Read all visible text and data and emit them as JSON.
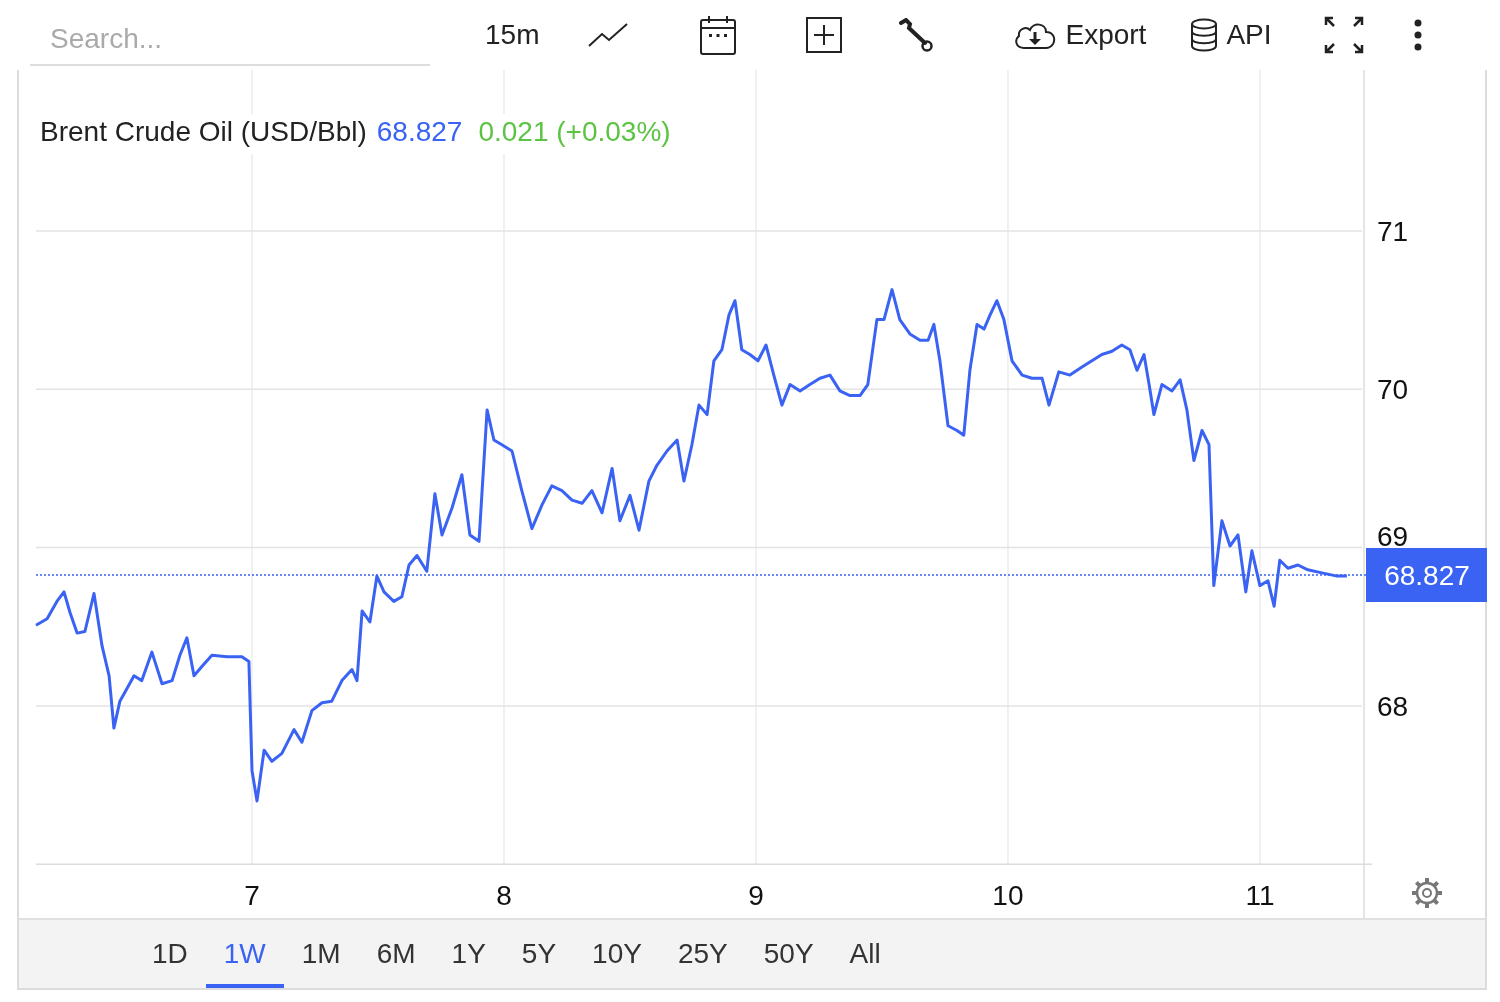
{
  "toolbar": {
    "search": {
      "placeholder": "Search..."
    },
    "interval": "15m",
    "export_label": "Export",
    "api_label": "API"
  },
  "legend": {
    "price": "68.827",
    "change": "0.021 (+0.03%)"
  },
  "chart_data": {
    "type": "line",
    "title": "Brent Crude Oil (USD/Bbl)",
    "grid": true,
    "xlim": [
      6.143,
      11.405
    ],
    "ylim": [
      67,
      72
    ],
    "ref_lines": [
      {
        "axis": "y",
        "value": 68.827,
        "label": "68.827",
        "color": "#3a63f3"
      }
    ],
    "xticks": [
      {
        "value": 7,
        "label": "7"
      },
      {
        "value": 8,
        "label": "8"
      },
      {
        "value": 9,
        "label": "9"
      },
      {
        "value": 10,
        "label": "10"
      },
      {
        "value": 11,
        "label": "11"
      }
    ],
    "yticks": [
      68,
      69,
      70,
      71
    ],
    "x": [
      6.143,
      6.187,
      6.226,
      6.254,
      6.278,
      6.306,
      6.337,
      6.373,
      6.405,
      6.433,
      6.452,
      6.476,
      6.504,
      6.532,
      6.563,
      6.603,
      6.643,
      6.683,
      6.714,
      6.742,
      6.77,
      6.802,
      6.841,
      6.901,
      6.96,
      6.988,
      7.0,
      7.02,
      7.048,
      7.079,
      7.119,
      7.167,
      7.198,
      7.238,
      7.278,
      7.317,
      7.357,
      7.397,
      7.417,
      7.437,
      7.468,
      7.496,
      7.524,
      7.563,
      7.595,
      7.623,
      7.655,
      7.694,
      7.726,
      7.754,
      7.794,
      7.833,
      7.865,
      7.901,
      7.933,
      7.96,
      7.992,
      8.032,
      8.071,
      8.111,
      8.151,
      8.19,
      8.23,
      8.27,
      8.31,
      8.349,
      8.389,
      8.429,
      8.46,
      8.5,
      8.536,
      8.575,
      8.607,
      8.647,
      8.687,
      8.714,
      8.746,
      8.774,
      8.806,
      8.833,
      8.865,
      8.893,
      8.917,
      8.944,
      8.976,
      9.008,
      9.04,
      9.071,
      9.103,
      9.135,
      9.175,
      9.214,
      9.254,
      9.294,
      9.333,
      9.373,
      9.413,
      9.444,
      9.48,
      9.508,
      9.54,
      9.571,
      9.611,
      9.651,
      9.683,
      9.706,
      9.73,
      9.762,
      9.798,
      9.825,
      9.849,
      9.877,
      9.905,
      9.929,
      9.956,
      9.984,
      10.016,
      10.056,
      10.095,
      10.135,
      10.163,
      10.202,
      10.246,
      10.294,
      10.333,
      10.373,
      10.413,
      10.452,
      10.484,
      10.512,
      10.54,
      10.56,
      10.579,
      10.611,
      10.651,
      10.683,
      10.71,
      10.738,
      10.77,
      10.798,
      10.817,
      10.849,
      10.881,
      10.913,
      10.944,
      10.968,
      11.0,
      11.032,
      11.056,
      11.079,
      11.111,
      11.151,
      11.19,
      11.246,
      11.306,
      11.345
    ],
    "series": [
      {
        "color": "#3a63f3",
        "values": [
          68.51,
          68.55,
          68.66,
          68.72,
          68.59,
          68.46,
          68.47,
          68.71,
          68.38,
          68.19,
          67.86,
          68.03,
          68.11,
          68.19,
          68.16,
          68.34,
          68.14,
          68.16,
          68.32,
          68.43,
          68.19,
          68.25,
          68.32,
          68.31,
          68.31,
          68.28,
          67.59,
          67.4,
          67.72,
          67.65,
          67.7,
          67.85,
          67.77,
          67.97,
          68.02,
          68.03,
          68.16,
          68.23,
          68.16,
          68.6,
          68.53,
          68.82,
          68.72,
          68.66,
          68.69,
          68.89,
          68.95,
          68.85,
          69.34,
          69.08,
          69.25,
          69.46,
          69.08,
          69.04,
          69.87,
          69.68,
          69.65,
          69.61,
          69.36,
          69.12,
          69.27,
          69.39,
          69.36,
          69.3,
          69.28,
          69.36,
          69.22,
          69.5,
          69.17,
          69.33,
          69.11,
          69.42,
          69.52,
          69.61,
          69.68,
          69.42,
          69.65,
          69.9,
          69.84,
          70.18,
          70.25,
          70.47,
          70.56,
          70.25,
          70.22,
          70.18,
          70.28,
          70.09,
          69.9,
          70.03,
          69.99,
          70.03,
          70.07,
          70.09,
          69.99,
          69.96,
          69.96,
          70.03,
          70.44,
          70.44,
          70.63,
          70.44,
          70.35,
          70.31,
          70.31,
          70.41,
          70.18,
          69.77,
          69.74,
          69.71,
          70.12,
          70.41,
          70.38,
          70.47,
          70.56,
          70.44,
          70.18,
          70.09,
          70.07,
          70.07,
          69.9,
          70.11,
          70.09,
          70.14,
          70.18,
          70.22,
          70.24,
          70.28,
          70.25,
          70.12,
          70.22,
          70.03,
          69.84,
          70.03,
          69.99,
          70.06,
          69.87,
          69.55,
          69.74,
          69.65,
          68.76,
          69.17,
          69.01,
          69.08,
          68.72,
          68.98,
          68.76,
          68.79,
          68.63,
          68.92,
          68.87,
          68.89,
          68.86,
          68.84,
          68.82,
          68.82
        ]
      }
    ]
  },
  "ranges": [
    {
      "label": "1D",
      "selected": false
    },
    {
      "label": "1W",
      "selected": true
    },
    {
      "label": "1M",
      "selected": false
    },
    {
      "label": "6M",
      "selected": false
    },
    {
      "label": "1Y",
      "selected": false
    },
    {
      "label": "5Y",
      "selected": false
    },
    {
      "label": "10Y",
      "selected": false
    },
    {
      "label": "25Y",
      "selected": false
    },
    {
      "label": "50Y",
      "selected": false
    },
    {
      "label": "All",
      "selected": false
    }
  ]
}
